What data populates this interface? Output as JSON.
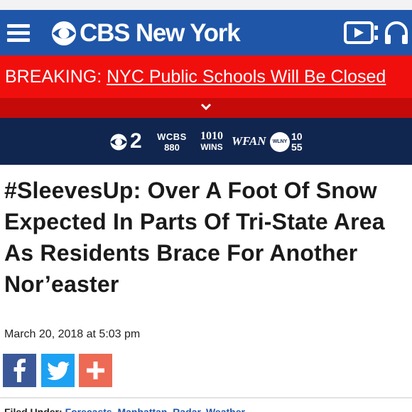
{
  "header": {
    "brand": "CBS New York",
    "colors": {
      "header_bg": "#1f56a8",
      "breaking_bg": "#f10f0e",
      "stations_bg": "#10264f"
    },
    "icons": [
      "menu-icon",
      "cbs-eye-icon",
      "video-icon",
      "headphones-icon"
    ]
  },
  "breaking": {
    "prefix": "BREAKING:",
    "link": "NYC Public Schools Will Be Closed"
  },
  "stations": {
    "cbs2": "2",
    "wcbs_top": "WCBS",
    "wcbs_bottom": "880",
    "wins_top": "1010",
    "wins_bottom": "WINS",
    "wfan": "WFAN",
    "wlny_badge": "WLNY",
    "wlny_top": "10",
    "wlny_bottom": "55"
  },
  "article": {
    "headline": "#SleevesUp: Over A Foot Of Snow Expected In Parts Of Tri-State Area As Residents Brace For Another Nor’easter",
    "date": "March 20, 2018 at 5:03 pm",
    "filed_label": "Filed Under:",
    "filed_tags": "Forecasts, Manhattan, Radar, Weather"
  },
  "share": {
    "icons": [
      "facebook-icon",
      "twitter-icon",
      "plus-icon"
    ],
    "colors": {
      "facebook": "#3b5998",
      "twitter": "#1da1f2",
      "more": "#ed6a55"
    }
  }
}
